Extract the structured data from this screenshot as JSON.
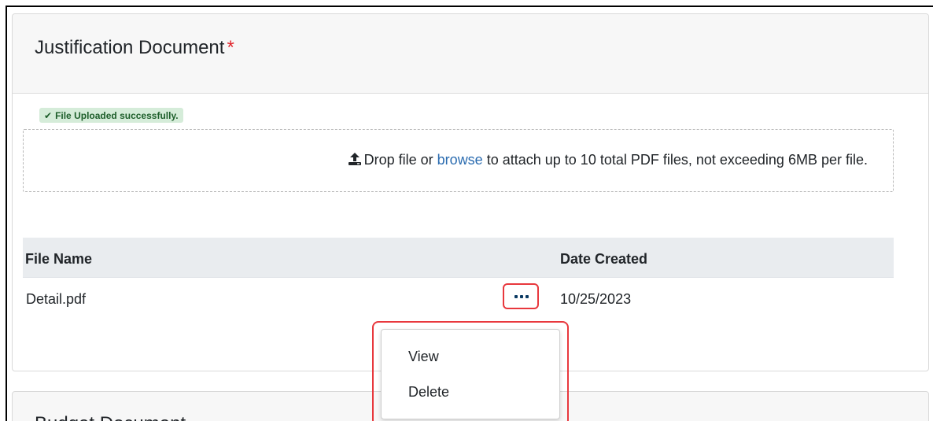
{
  "justification": {
    "title": "Justification Document",
    "required_marker": "*",
    "upload_status": "File Uploaded successfully.",
    "dropzone": {
      "prefix": "Drop file or",
      "browse_label": "browse",
      "suffix": "to attach up to 10 total PDF files, not exceeding 6MB per file."
    },
    "table": {
      "columns": [
        "File Name",
        "Date Created"
      ],
      "rows": [
        {
          "file_name": "Detail.pdf",
          "date_created": "10/25/2023"
        }
      ]
    },
    "row_menu": {
      "items": [
        "View",
        "Delete"
      ]
    }
  },
  "budget": {
    "title": "Budget Document"
  },
  "colors": {
    "accent_link": "#2b6cb0",
    "required": "#e0242b",
    "success_bg": "#d5ecd9",
    "highlight": "#e8383d"
  }
}
